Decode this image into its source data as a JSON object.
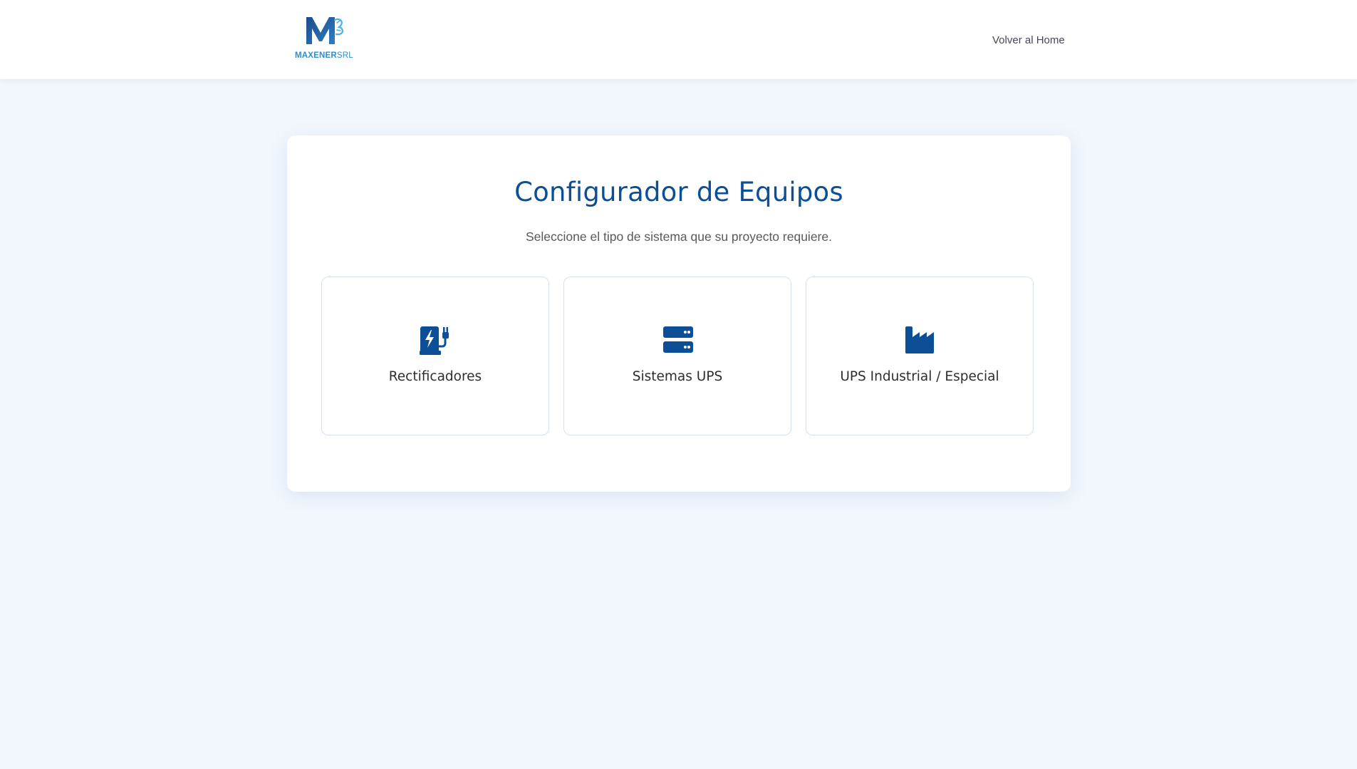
{
  "header": {
    "logo": {
      "text_main": "MAXENER",
      "text_suffix": "SRL",
      "icon": "maxener-logo-icon"
    },
    "nav_home_label": "Volver al Home"
  },
  "main": {
    "title": "Configurador de Equipos",
    "subtitle": "Seleccione el tipo de sistema que su proyecto requiere.",
    "options": [
      {
        "label": "Rectificadores",
        "icon": "charging-station-icon"
      },
      {
        "label": "Sistemas UPS",
        "icon": "server-icon"
      },
      {
        "label": "UPS Industrial / Especial",
        "icon": "industry-icon"
      }
    ]
  },
  "colors": {
    "background": "#f2f7fd",
    "primary": "#0c4f96",
    "logo_accent": "#2a8fd0",
    "text": "#2e2e2e",
    "muted_text": "#595959",
    "card_border": "#d5e2ee"
  }
}
